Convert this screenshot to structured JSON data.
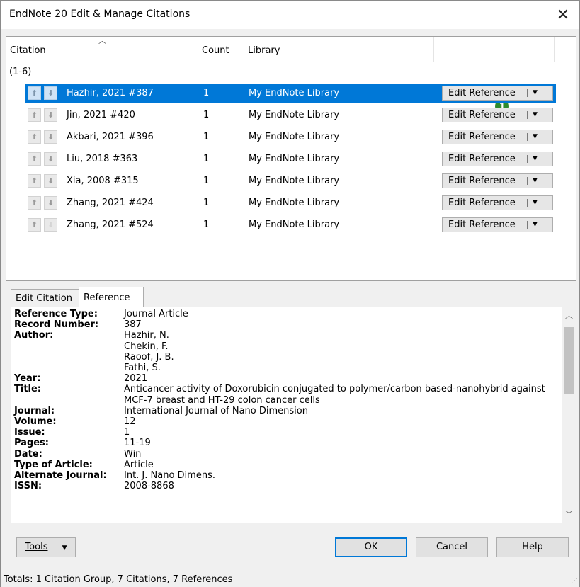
{
  "window": {
    "title": "EndNote 20 Edit & Manage Citations",
    "close_label": "✕"
  },
  "list": {
    "columns": {
      "citation": "Citation",
      "count": "Count",
      "library": "Library"
    },
    "group_label": "(1-6)",
    "badge": "1",
    "rows": [
      {
        "citation": "Hazhir, 2021 #387",
        "count": "1",
        "library": "My EndNote Library",
        "button": "Edit Reference",
        "selected": true
      },
      {
        "citation": "Jin, 2021 #420",
        "count": "1",
        "library": "My EndNote Library",
        "button": "Edit Reference"
      },
      {
        "citation": "Akbari, 2021 #396",
        "count": "1",
        "library": "My EndNote Library",
        "button": "Edit Reference"
      },
      {
        "citation": "Liu, 2018 #363",
        "count": "1",
        "library": "My EndNote Library",
        "button": "Edit Reference"
      },
      {
        "citation": "Xia, 2008 #315",
        "count": "1",
        "library": "My EndNote Library",
        "button": "Edit Reference"
      },
      {
        "citation": "Zhang, 2021 #424",
        "count": "1",
        "library": "My EndNote Library",
        "button": "Edit Reference"
      },
      {
        "citation": "Zhang, 2021 #524",
        "count": "1",
        "library": "My EndNote Library",
        "button": "Edit Reference"
      }
    ]
  },
  "tabs": {
    "edit_citation": "Edit Citation",
    "reference": "Reference"
  },
  "reference": {
    "fields": [
      {
        "key": "Reference Type:",
        "value": "Journal Article"
      },
      {
        "key": "Record Number:",
        "value": "387"
      },
      {
        "key": "Author:",
        "value": "Hazhir, N."
      },
      {
        "key": "",
        "value": "Chekin, F."
      },
      {
        "key": "",
        "value": "Raoof, J. B."
      },
      {
        "key": "",
        "value": "Fathi, S."
      },
      {
        "key": "Year:",
        "value": "2021"
      },
      {
        "key": "Title:",
        "value": "Anticancer activity of Doxorubicin conjugated to polymer/carbon based-nanohybrid against"
      },
      {
        "key": "",
        "value": "MCF-7 breast and HT-29 colon cancer cells"
      },
      {
        "key": "Journal:",
        "value": "International Journal of Nano Dimension"
      },
      {
        "key": "Volume:",
        "value": "12"
      },
      {
        "key": "Issue:",
        "value": "1"
      },
      {
        "key": "Pages:",
        "value": "11-19"
      },
      {
        "key": "Date:",
        "value": "Win"
      },
      {
        "key": "Type of Article:",
        "value": "Article"
      },
      {
        "key": "Alternate Journal:",
        "value": "Int. J. Nano Dimens."
      },
      {
        "key": "ISSN:",
        "value": "2008-8868"
      }
    ]
  },
  "buttons": {
    "tools": "Tools",
    "ok": "OK",
    "cancel": "Cancel",
    "help": "Help"
  },
  "status": {
    "text": "Totals: 1 Citation Group, 7 Citations, 7 References"
  },
  "colors": {
    "selection": "#0078d7",
    "badge": "#2e8b2e"
  }
}
